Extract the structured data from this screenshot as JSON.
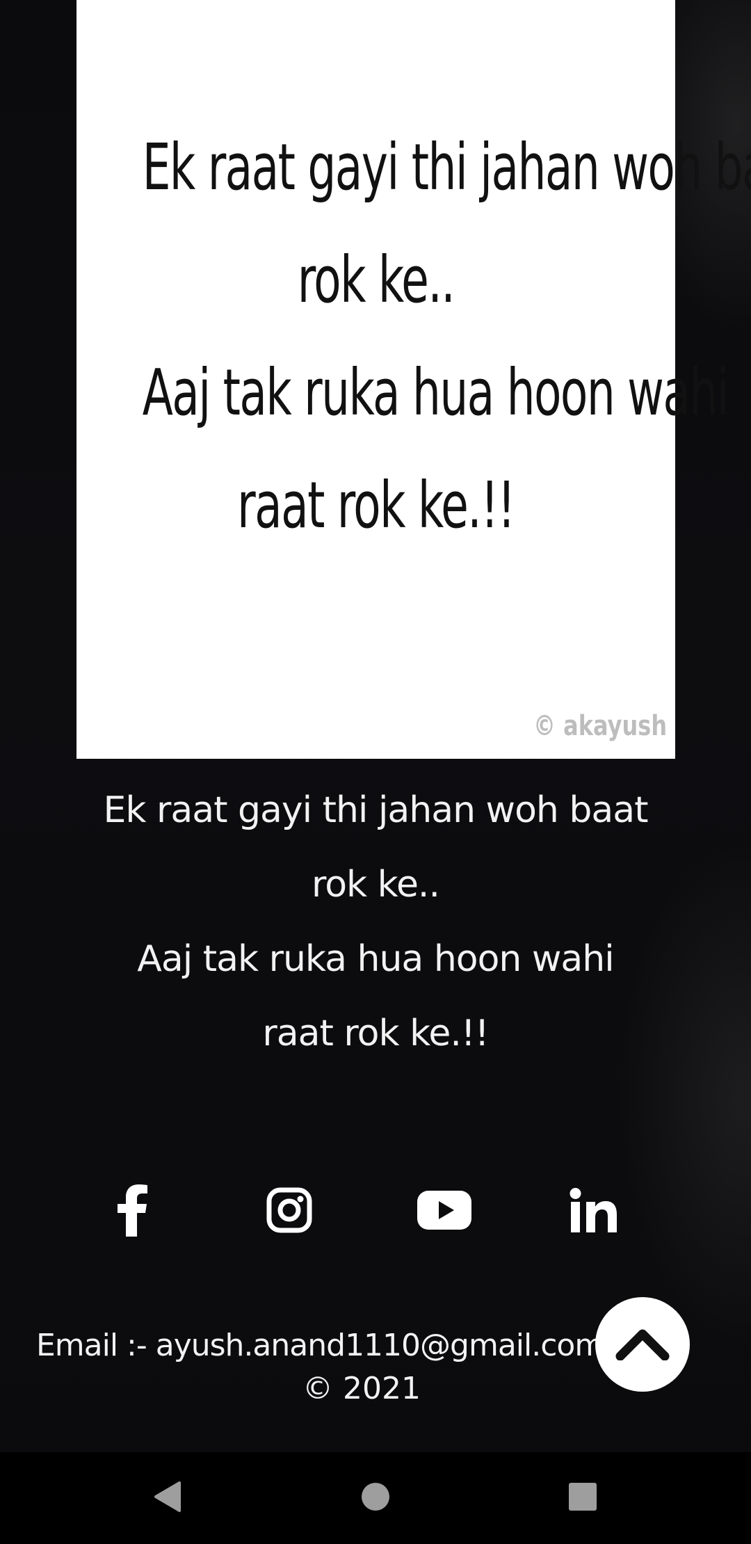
{
  "quote_image": {
    "lines": [
      "Ek raat gayi thi jahan woh baat",
      "rok ke..",
      "Aaj tak ruka hua hoon wahi",
      "raat rok ke.!!"
    ],
    "watermark": "© akayush"
  },
  "caption": {
    "lines": [
      "Ek raat gayi thi jahan woh baat",
      "rok ke..",
      "Aaj tak ruka hua hoon wahi",
      "raat rok ke.!!"
    ]
  },
  "social": {
    "icons": [
      "facebook-icon",
      "instagram-icon",
      "youtube-icon",
      "linkedin-icon"
    ]
  },
  "footer": {
    "email_text": "Email :- ayush.anand1110@gmail.com | Ak_",
    "copyright": "© 2021"
  },
  "scroll_top": {
    "icon": "chevron-up-icon"
  },
  "navbar": {
    "icons": [
      "back-icon",
      "home-icon",
      "recents-icon"
    ],
    "color": "#9e9e9e"
  }
}
